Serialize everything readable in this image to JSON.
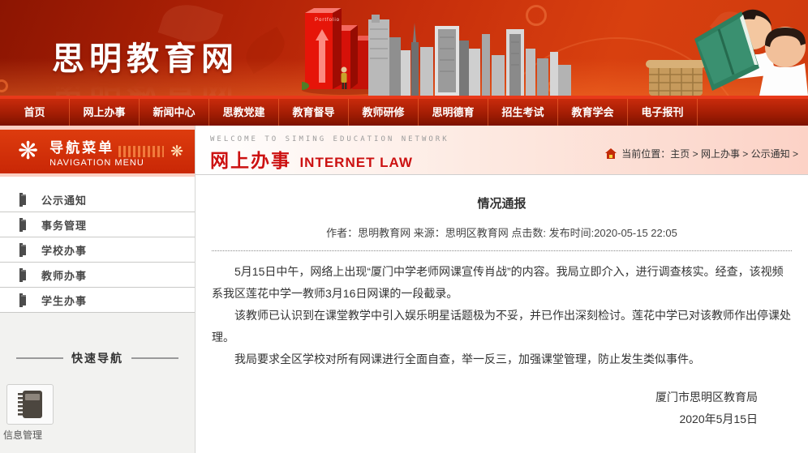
{
  "banner": {
    "site_title": "思明教育网",
    "portfolio_label": "Portfolio"
  },
  "nav": {
    "items": [
      "首页",
      "网上办事",
      "新闻中心",
      "思教党建",
      "教育督导",
      "教师研修",
      "思明德育",
      "招生考试",
      "教育学会",
      "电子报刊"
    ]
  },
  "sidebar": {
    "menu_title_cn": "导航菜单",
    "menu_title_en": "NAVIGATION MENU",
    "items": [
      "公示通知",
      "事务管理",
      "学校办事",
      "教师办事",
      "学生办事"
    ],
    "quick_nav_title": "快速导航",
    "quick_link_label": "信息管理"
  },
  "main": {
    "welcome_text": "WELCOME TO SIMING EDUCATION NETWORK",
    "section_title_cn": "网上办事",
    "section_title_en": "INTERNET LAW",
    "breadcrumb": "当前位置：主页 > 网上办事 > 公示通知 >",
    "article": {
      "title": "情况通报",
      "meta": "作者：思明教育网 来源：思明区教育网 点击数: 发布时间:2020-05-15 22:05",
      "paragraphs": [
        "5月15日中午，网络上出现“厦门中学老师网课宣传肖战”的内容。我局立即介入，进行调查核实。经查，该视频系我区莲花中学一教师3月16日网课的一段截录。",
        "该教师已认识到在课堂教学中引入娱乐明星话题极为不妥，并已作出深刻检讨。莲花中学已对该教师作出停课处理。",
        "我局要求全区学校对所有网课进行全面自查，举一反三，加强课堂管理，防止发生类似事件。"
      ],
      "signature": "厦门市思明区教育局",
      "date": "2020年5月15日"
    }
  },
  "colors": {
    "accent_red": "#cc1111",
    "nav_dark_red": "#7c1200",
    "banner_orange": "#d8400f",
    "breadcrumb_pink": "#fcd2c6",
    "bar_red": "#e31408"
  }
}
